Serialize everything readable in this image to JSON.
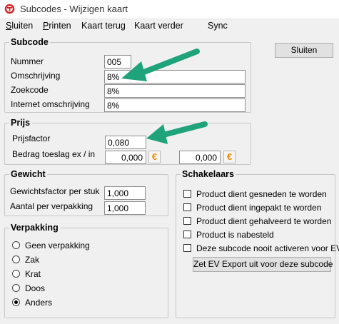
{
  "window": {
    "title": "Subcodes - Wijzigen kaart"
  },
  "menu": {
    "items": [
      {
        "key": "S",
        "rest": "luiten"
      },
      {
        "key": "P",
        "rest": "rinten"
      },
      {
        "key": "",
        "rest": "Kaart terug"
      },
      {
        "key": "",
        "rest": "Kaart verder"
      },
      {
        "key": "",
        "rest": "Sync"
      }
    ]
  },
  "subcode": {
    "legend": "Subcode",
    "nummer_label": "Nummer",
    "nummer_value": "005",
    "omschrijving_label": "Omschrijving",
    "omschrijving_value": "8%",
    "zoekcode_label": "Zoekcode",
    "zoekcode_value": "8%",
    "internet_label": "Internet omschrijving",
    "internet_value": "8%"
  },
  "sluiten_button": "Sluiten",
  "prijs": {
    "legend": "Prijs",
    "prijsfactor_label": "Prijsfactor",
    "prijsfactor_value": "0,080",
    "toeslag_label": "Bedrag toeslag ex / in",
    "toeslag_ex_value": "0,000",
    "toeslag_in_value": "0,000",
    "euro_symbol": "€"
  },
  "gewicht": {
    "legend": "Gewicht",
    "factor_label": "Gewichtsfactor per stuk",
    "factor_value": "1,000",
    "aantal_label": "Aantal per verpakking",
    "aantal_value": "1,000"
  },
  "verpakking": {
    "legend": "Verpakking",
    "options": [
      "Geen verpakking",
      "Zak",
      "Krat",
      "Doos",
      "Anders"
    ],
    "selected": "Anders"
  },
  "schakelaars": {
    "legend": "Schakelaars",
    "checks": [
      "Product dient gesneden te worden",
      "Product dient ingepakt te worden",
      "Product dient gehalveerd te worden",
      "Product is nabesteld",
      "Deze subcode nooit activeren voor EV"
    ],
    "ev_button": "Zet EV Export uit voor deze subcode"
  },
  "colors": {
    "annotation_arrow": "#1fa37a",
    "euro_icon": "#f08a00"
  }
}
